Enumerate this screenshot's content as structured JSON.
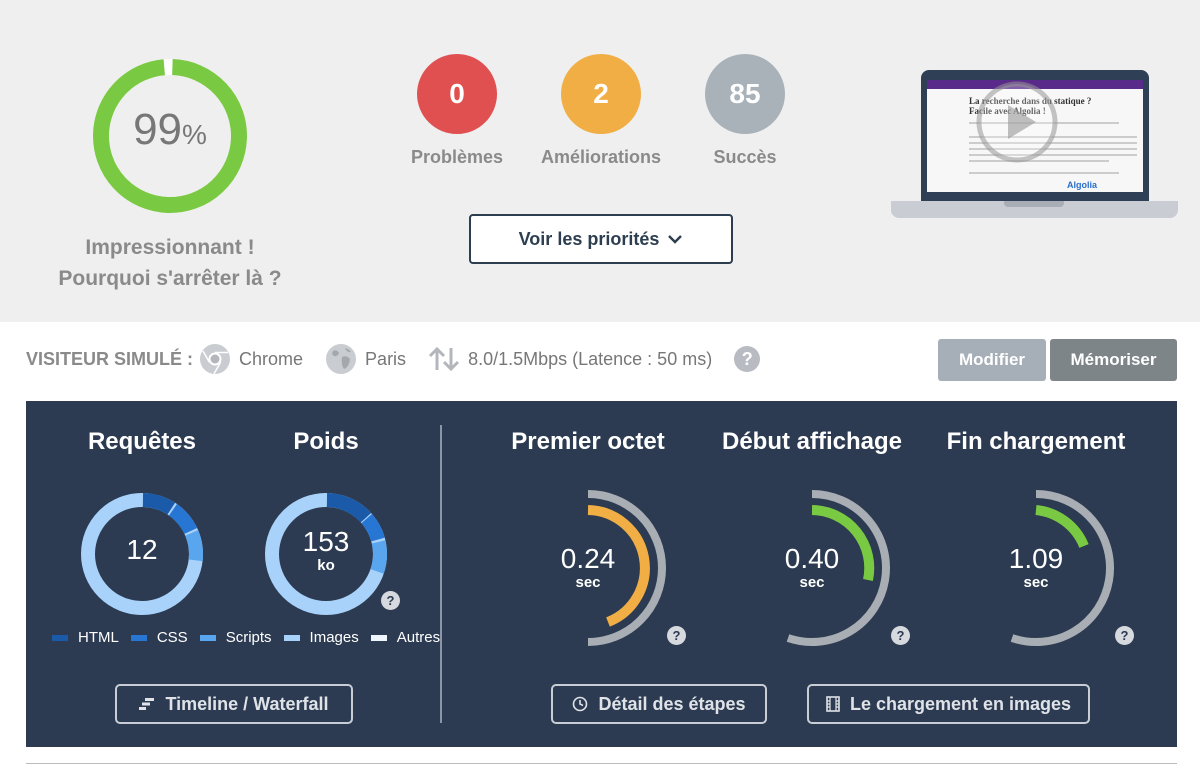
{
  "score": {
    "value": "99",
    "unit": "%",
    "percent": 99,
    "color": "#7ac943",
    "message_line1": "Impressionnant !",
    "message_line2": "Pourquoi s'arrêter là ?"
  },
  "stats": [
    {
      "value": "0",
      "label": "Problèmes",
      "color": "#e05050"
    },
    {
      "value": "2",
      "label": "Améliorations",
      "color": "#f0ae45"
    },
    {
      "value": "85",
      "label": "Succès",
      "color": "#a9b2b9"
    }
  ],
  "priorities_button": {
    "label": "Voir les priorités",
    "icon": "chevron-down-icon"
  },
  "preview": {
    "title_line1": "La recherche dans du statique ?",
    "title_line2": "Facile avec Algolia !",
    "brand": "Algolia",
    "icon": "play-icon"
  },
  "visitor": {
    "label": "VISITEUR SIMULÉ :",
    "browser": "Chrome",
    "location": "Paris",
    "connection": "8.0/1.5Mbps (Latence : 50 ms)",
    "help": "?",
    "modify_label": "Modifier",
    "save_label": "Mémoriser"
  },
  "metrics": {
    "requests": {
      "title": "Requêtes",
      "value": "12"
    },
    "weight": {
      "title": "Poids",
      "value": "153",
      "unit": "ko",
      "help": "?"
    },
    "legend": [
      {
        "label": "HTML",
        "color": "#1b5aa8"
      },
      {
        "label": "CSS",
        "color": "#2776d4"
      },
      {
        "label": "Scripts",
        "color": "#5aa6ee"
      },
      {
        "label": "Images",
        "color": "#a9d2fb"
      },
      {
        "label": "Autres",
        "color": "#eef5fd"
      }
    ],
    "timeline_button": "Timeline / Waterfall",
    "first_byte": {
      "title": "Premier octet",
      "value": "0.24",
      "unit": "sec",
      "color": "#f0ae45",
      "help": "?"
    },
    "start_render": {
      "title": "Début affichage",
      "value": "0.40",
      "unit": "sec",
      "color": "#7ac943",
      "help": "?"
    },
    "load_end": {
      "title": "Fin chargement",
      "value": "1.09",
      "unit": "sec",
      "color": "#7ac943",
      "help": "?"
    },
    "steps_button": "Détail des étapes",
    "images_button": "Le chargement en images"
  }
}
